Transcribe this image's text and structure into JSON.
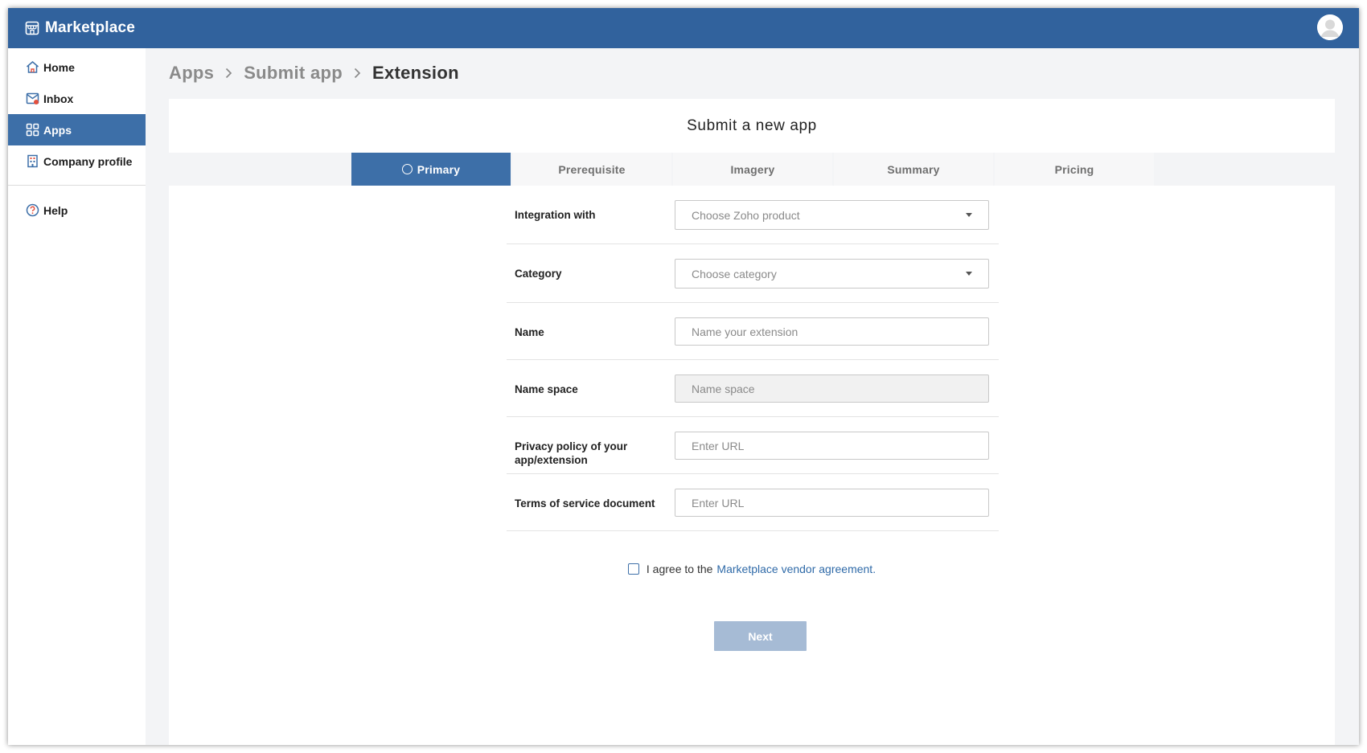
{
  "app": {
    "title": "Marketplace"
  },
  "sidebar": {
    "items": [
      {
        "label": "Home",
        "icon": "home-icon"
      },
      {
        "label": "Inbox",
        "icon": "inbox-icon"
      },
      {
        "label": "Apps",
        "icon": "apps-grid-icon",
        "active": true
      },
      {
        "label": "Company profile",
        "icon": "building-icon"
      }
    ],
    "help": {
      "label": "Help",
      "icon": "help-circle-icon"
    }
  },
  "breadcrumb": [
    "Apps",
    "Submit app",
    "Extension"
  ],
  "card": {
    "title": "Submit a new app"
  },
  "tabs": [
    {
      "label": "Primary",
      "active": true
    },
    {
      "label": "Prerequisite"
    },
    {
      "label": "Imagery"
    },
    {
      "label": "Summary"
    },
    {
      "label": "Pricing"
    }
  ],
  "form": {
    "integration": {
      "label": "Integration with",
      "placeholder": "Choose Zoho product"
    },
    "category": {
      "label": "Category",
      "placeholder": "Choose category"
    },
    "name": {
      "label": "Name",
      "placeholder": "Name your extension"
    },
    "namespace": {
      "label": "Name space",
      "placeholder": "Name space"
    },
    "privacy": {
      "label_line1": "Privacy policy of your",
      "label_line2": "app/extension",
      "placeholder": "Enter URL"
    },
    "terms": {
      "label": "Terms of service document",
      "placeholder": "Enter URL"
    }
  },
  "agreement": {
    "prefix": "I agree to the",
    "link": "Marketplace vendor agreement.",
    "checked": false
  },
  "actions": {
    "next_label": "Next"
  },
  "colors": {
    "brand": "#31629d",
    "active": "#3d6fa8",
    "link": "#2f6aa8",
    "next_disabled": "#a6bbd5"
  }
}
